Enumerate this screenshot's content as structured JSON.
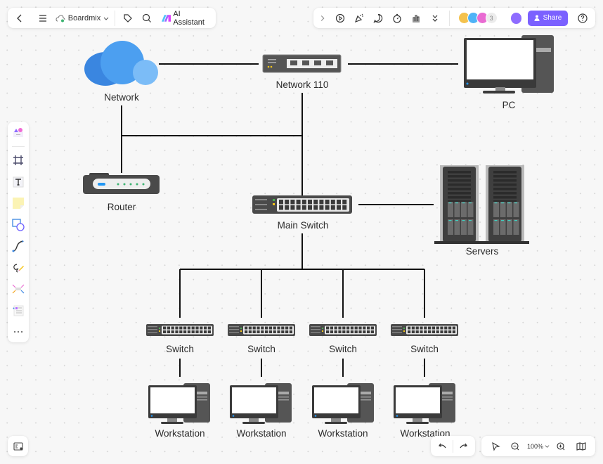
{
  "app": {
    "name": "Boardmix",
    "ai_label": "AI Assistant",
    "share_label": "Share",
    "collaborator_count": "3",
    "zoom_level": "100%",
    "accent_color": "#7b61ff"
  },
  "toolbar_top_left": {
    "items": [
      "back-icon",
      "menu-icon",
      "cloud-icon",
      "tag-icon",
      "search-icon",
      "ai-icon"
    ]
  },
  "toolbar_top_right": {
    "items": [
      "expand-icon",
      "present-icon",
      "celebrate-icon",
      "comment-icon",
      "timer-icon",
      "vote-icon",
      "more-icon",
      "help-icon"
    ]
  },
  "left_toolbar": {
    "tools": [
      "templates",
      "frame",
      "text",
      "sticky-note",
      "shape",
      "connector",
      "pen",
      "mindmap",
      "more-tools",
      "more"
    ]
  },
  "diagram": {
    "nodes": [
      {
        "id": "network",
        "label": "Network",
        "type": "cloud"
      },
      {
        "id": "network110",
        "label": "Network 110",
        "type": "switch-small"
      },
      {
        "id": "pc",
        "label": "PC",
        "type": "pc"
      },
      {
        "id": "router",
        "label": "Router",
        "type": "router"
      },
      {
        "id": "main-switch",
        "label": "Main Switch",
        "type": "switch"
      },
      {
        "id": "servers",
        "label": "Servers",
        "type": "servers"
      },
      {
        "id": "switch1",
        "label": "Switch",
        "type": "switch"
      },
      {
        "id": "switch2",
        "label": "Switch",
        "type": "switch"
      },
      {
        "id": "switch3",
        "label": "Switch",
        "type": "switch"
      },
      {
        "id": "switch4",
        "label": "Switch",
        "type": "switch"
      },
      {
        "id": "ws1",
        "label": "Workstation",
        "type": "pc"
      },
      {
        "id": "ws2",
        "label": "Workstation",
        "type": "pc"
      },
      {
        "id": "ws3",
        "label": "Workstation",
        "type": "pc"
      },
      {
        "id": "ws4",
        "label": "Workstation",
        "type": "pc"
      }
    ],
    "edges": [
      [
        "network",
        "network110"
      ],
      [
        "network110",
        "pc"
      ],
      [
        "network",
        "router"
      ],
      [
        "network110",
        "main-switch"
      ],
      [
        "main-switch",
        "servers"
      ],
      [
        "main-switch",
        "switch1"
      ],
      [
        "main-switch",
        "switch2"
      ],
      [
        "main-switch",
        "switch3"
      ],
      [
        "main-switch",
        "switch4"
      ],
      [
        "switch1",
        "ws1"
      ],
      [
        "switch2",
        "ws2"
      ],
      [
        "switch3",
        "ws3"
      ],
      [
        "switch4",
        "ws4"
      ]
    ]
  }
}
